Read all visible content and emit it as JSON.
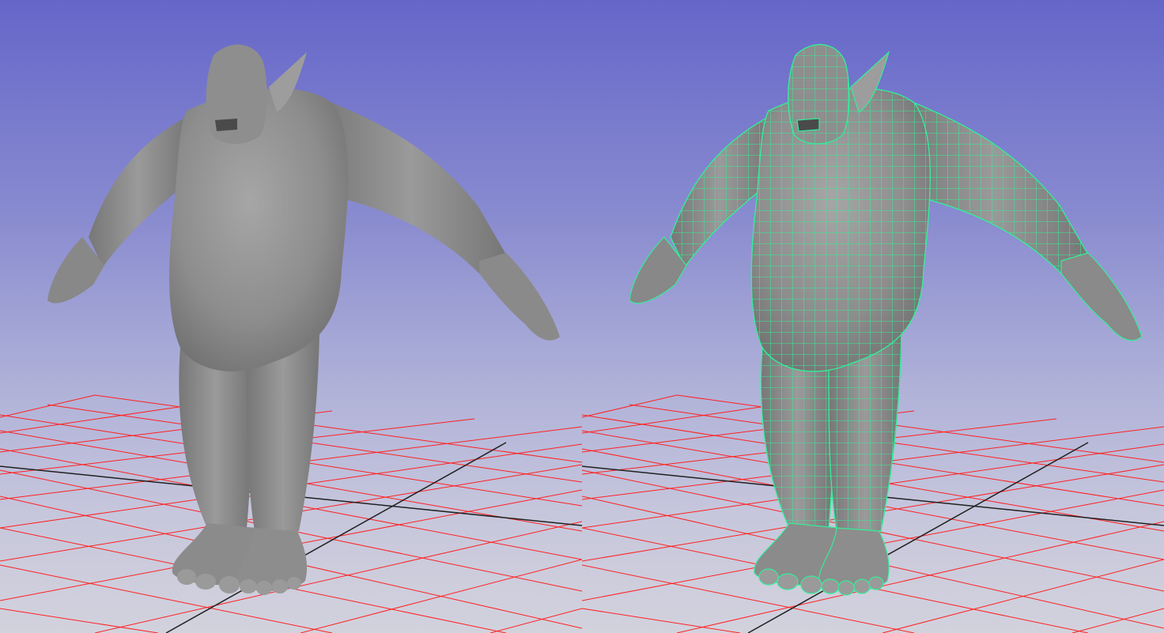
{
  "scene": {
    "viewports": [
      {
        "name": "left",
        "display_mode": "smooth-shaded",
        "wireframe_on_shaded": false
      },
      {
        "name": "right",
        "display_mode": "smooth-shaded",
        "wireframe_on_shaded": true
      }
    ],
    "model": "ogre-character-t-pose",
    "colors": {
      "background_top": "#6566c9",
      "background_bottom": "#d2d2dd",
      "grid_line": "#ff2020",
      "grid_axis": "#202020",
      "mesh_shade": "#8e8e8e",
      "wireframe": "#33ee99"
    }
  }
}
